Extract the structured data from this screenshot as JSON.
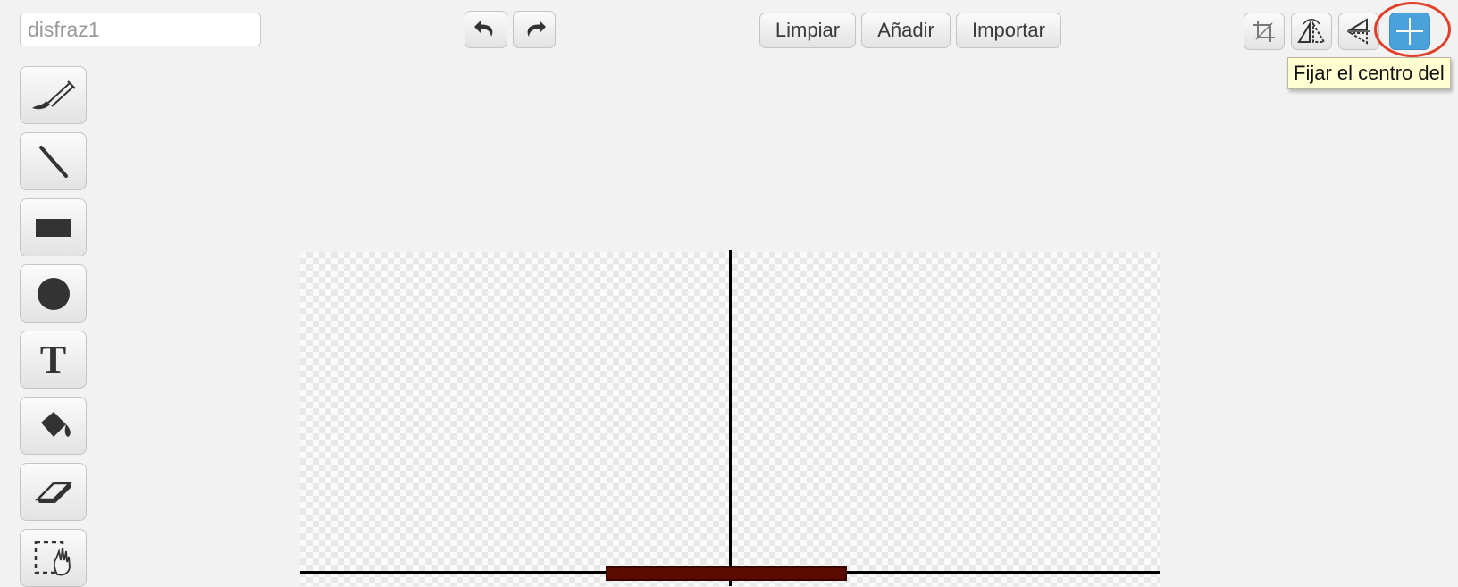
{
  "costume": {
    "name_value": "disfraz1"
  },
  "toolbar": {
    "clear_label": "Limpiar",
    "add_label": "Añadir",
    "import_label": "Importar"
  },
  "tools": [
    {
      "icon": "brush-icon"
    },
    {
      "icon": "line-icon"
    },
    {
      "icon": "rectangle-icon"
    },
    {
      "icon": "ellipse-icon"
    },
    {
      "icon": "text-icon",
      "glyph": "T"
    },
    {
      "icon": "paint-bucket-icon"
    },
    {
      "icon": "eraser-icon"
    },
    {
      "icon": "select-icon"
    }
  ],
  "tooltip": {
    "text": "Fijar el centro del"
  },
  "colors": {
    "active_button": "#4ba1dc",
    "highlight_ring": "#e0402a",
    "shape_fill": "#5a0a00"
  }
}
